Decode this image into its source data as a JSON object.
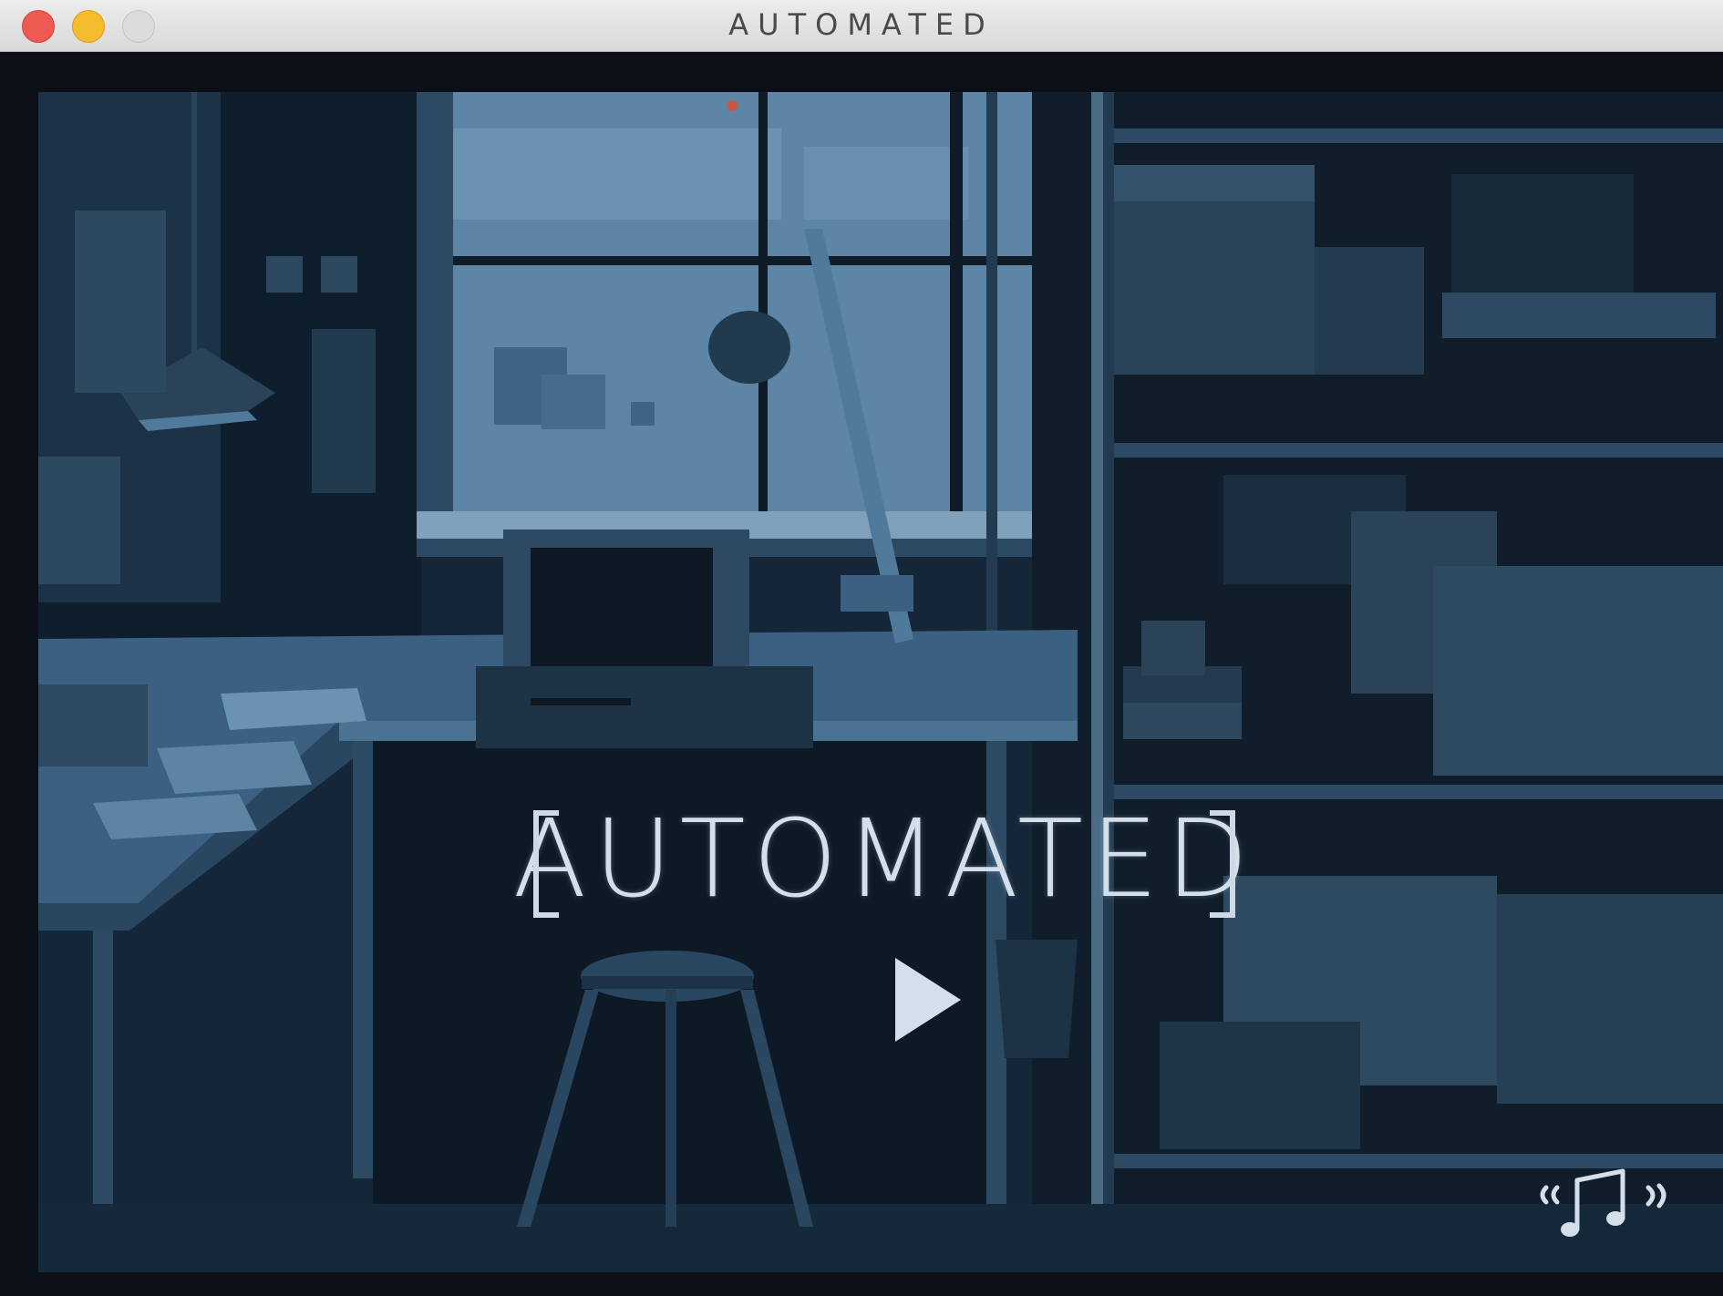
{
  "window": {
    "title": "AUTOMATED"
  },
  "game": {
    "logo_text": "AUTOMATED",
    "play_icon": "play-triangle-icon",
    "sound_icon": "music-note-sound-icon"
  },
  "colors": {
    "wall_dark": "#16283a",
    "window_light": "#5d86a6",
    "logo_text": "#d4dfe9",
    "lamp_dot": "#c8574a"
  }
}
